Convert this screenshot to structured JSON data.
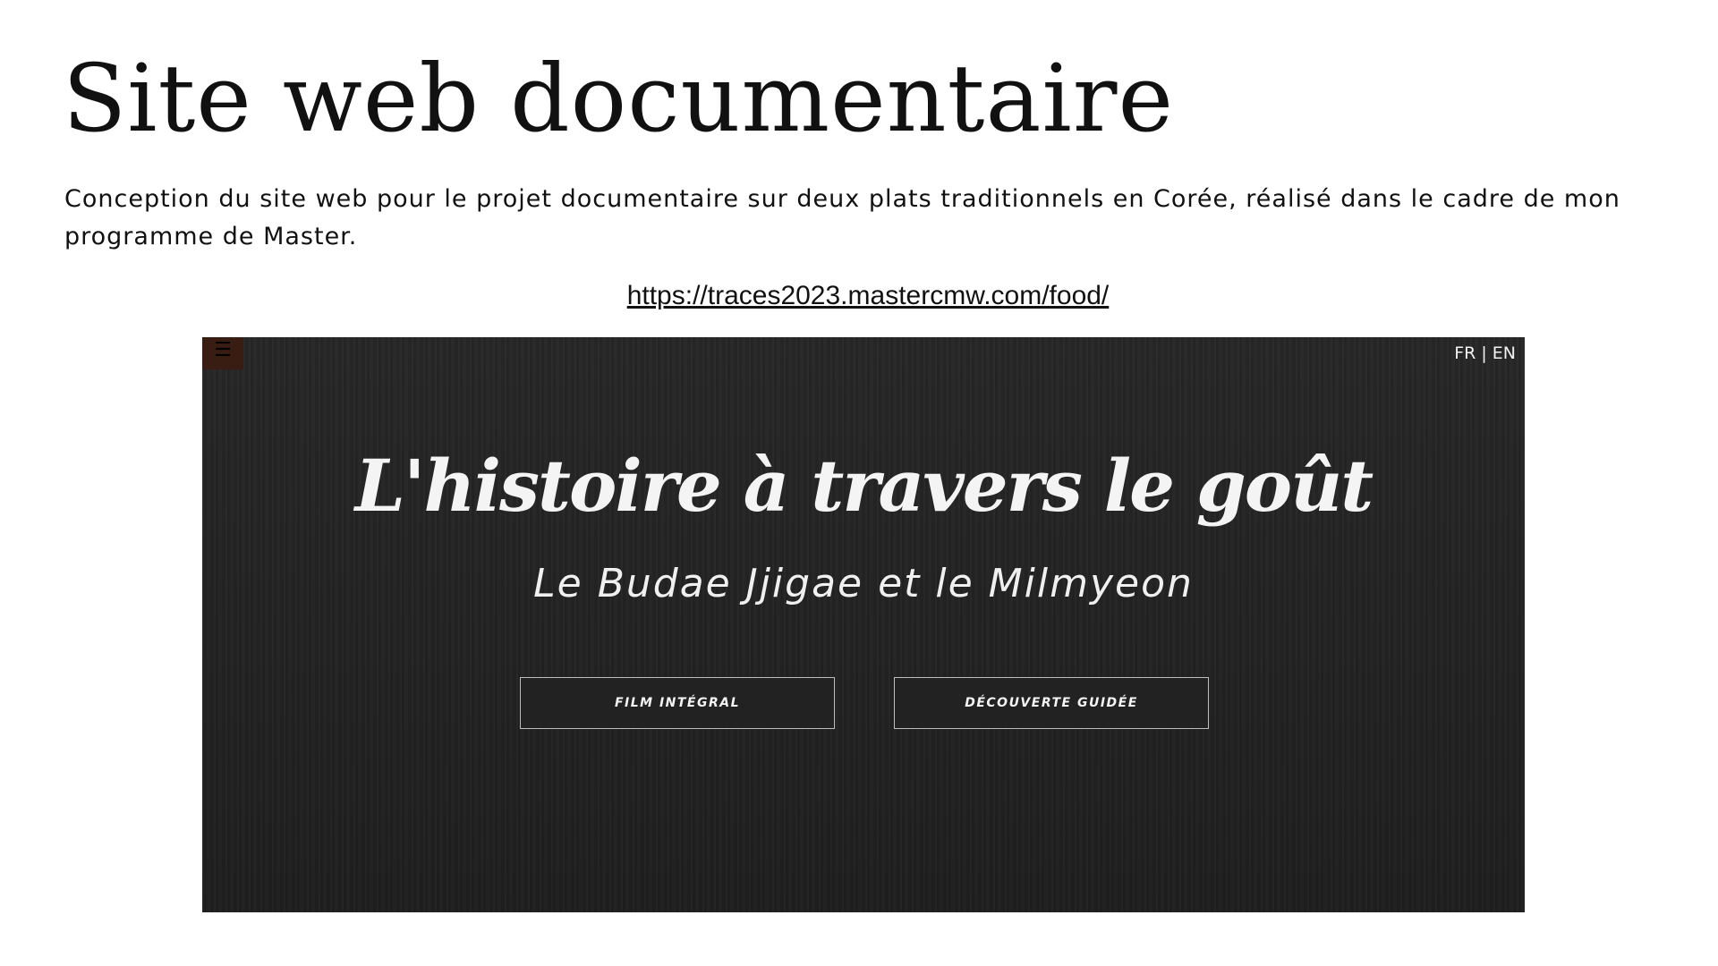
{
  "slide": {
    "title": "Site web documentaire",
    "description": "Conception du site web pour le projet documentaire sur deux plats traditionnels en Corée, réalisé dans le cadre de mon programme de Master.",
    "link": "https://traces2023.mastercmw.com/food/"
  },
  "preview": {
    "menu_icon": "hamburger-menu-icon",
    "menu_glyph": "☰",
    "lang_fr": "FR",
    "lang_separator": "|",
    "lang_en": "EN",
    "hero_title": "L'histoire à travers le goût",
    "hero_subtitle": "Le Budae Jjigae et le Milmyeon",
    "buttons": {
      "film": "FILM INTÉGRAL",
      "tour": "DÉCOUVERTE GUIDÉE"
    }
  },
  "colors": {
    "background": "#ffffff",
    "preview_background": "#232323",
    "menu_button": "#3a1d12",
    "hero_text": "#f4f4f4",
    "button_border": "#bdbdbd"
  }
}
